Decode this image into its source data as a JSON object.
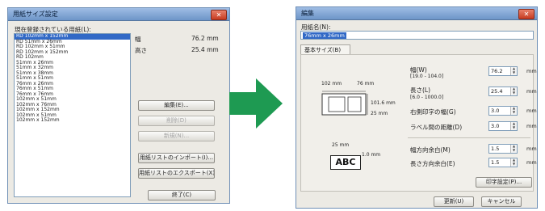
{
  "left_window": {
    "title": "用紙サイズ設定",
    "list_label": "現在登録されている用紙(L):",
    "list_items": [
      "RD 102mm x 152mm",
      "RD 51mm x 26mm",
      "RD 102mm x 51mm",
      "RD 102mm x 152mm",
      "RD 102mm",
      "51mm x 26mm",
      "51mm x 32mm",
      "51mm x 38mm",
      "51mm x 51mm",
      "76mm x 26mm",
      "76mm x 51mm",
      "76mm x 76mm",
      "102mm x 51mm",
      "102mm x 76mm",
      "102mm x 152mm",
      "102mm x 51mm",
      "102mm x 152mm"
    ],
    "width_label": "幅",
    "width_value": "76.2 mm",
    "height_label": "高さ",
    "height_value": "25.4 mm",
    "buttons": {
      "edit": "編集(E)...",
      "delete": "削除(D)",
      "new": "新規(N)...",
      "import": "用紙リストのインポート(I)...",
      "export": "用紙リストのエクスポート(X)...",
      "close": "終了(C)"
    }
  },
  "right_window": {
    "title": "編集",
    "name_label": "用紙名(N):",
    "name_value": "76mm x 26mm",
    "tab_label": "基本サイズ(B)",
    "diagram": {
      "top_left_dim": "102 mm",
      "top_right_dim": "76 mm",
      "side_dim_1": "101.6 mm",
      "side_dim_2": "25 mm",
      "abc_top_dim": "25 mm",
      "abc_side_dim": "1.0 mm",
      "abc_text": "ABC"
    },
    "fields": {
      "width_label": "幅(W)",
      "width_range": "[19.0 - 104.0]",
      "width_value": "76.2",
      "length_label": "長さ(L)",
      "length_range": "[6.0 - 1000.0]",
      "length_value": "25.4",
      "gap_label": "右側印字の幅(G)",
      "gap_value": "3.0",
      "offset_label": "ラベル間の距離(D)",
      "offset_value": "3.0",
      "hmargin_label": "幅方向余白(M)",
      "hmargin_value": "1.5",
      "vmargin_label": "長さ方向余白(E)",
      "vmargin_value": "1.5",
      "unit": "mm"
    },
    "buttons": {
      "print_settings": "印字設定(P)...",
      "ok": "更新(U)",
      "cancel": "キャンセル"
    }
  },
  "arrow_color": "#1e9a52"
}
